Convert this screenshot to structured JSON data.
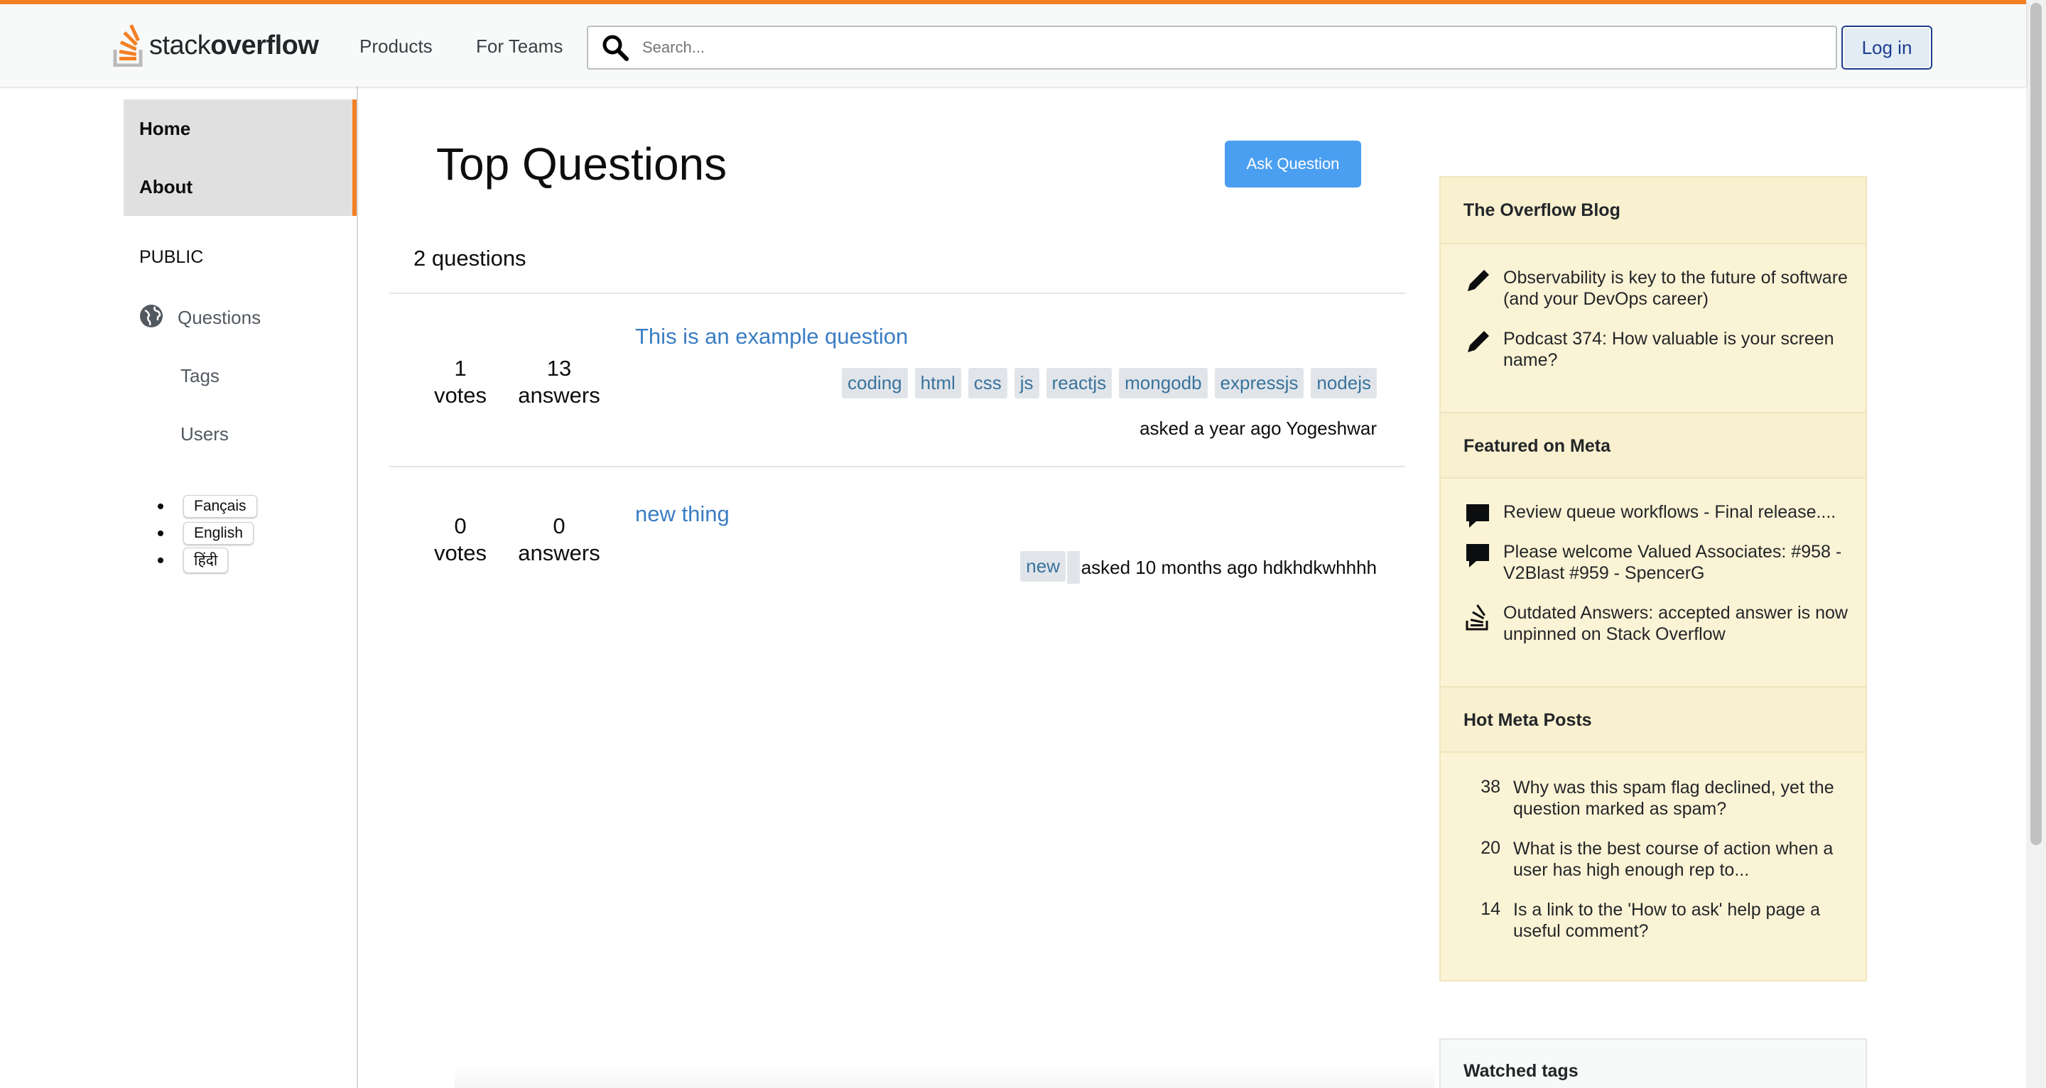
{
  "header": {
    "logo_text_light": "stack",
    "logo_text_bold": "overflow",
    "nav": [
      "Products",
      "For Teams"
    ],
    "search_placeholder": "Search...",
    "login_label": "Log in",
    "accent_color": "#f48024"
  },
  "sidebar": {
    "home_label": "Home",
    "about_label": "About",
    "public_label": "PUBLIC",
    "questions_label": "Questions",
    "tags_label": "Tags",
    "users_label": "Users",
    "languages": [
      "Fançais",
      "English",
      "हिंदी"
    ]
  },
  "main": {
    "title": "Top Questions",
    "ask_label": "Ask Question",
    "count_label": "2 questions",
    "questions": [
      {
        "votes": "1",
        "votes_label": "votes",
        "answers": "13",
        "answers_label": "answers",
        "title": "This is an example question",
        "tags": [
          "coding",
          "html",
          "css",
          "js",
          "reactjs",
          "mongodb",
          "expressjs",
          "nodejs"
        ],
        "asked": "asked a year ago Yogeshwar"
      },
      {
        "votes": "0",
        "votes_label": "votes",
        "answers": "0",
        "answers_label": "answers",
        "title": "new thing",
        "tags": [
          "new"
        ],
        "asked": "asked 10 months ago hdkhdkwhhhh"
      }
    ]
  },
  "widget": {
    "blog_heading": "The Overflow Blog",
    "blog_items": [
      {
        "icon": "pencil-icon",
        "text": "Observability is key to the future of software (and your DevOps career)"
      },
      {
        "icon": "pencil-icon",
        "text": "Podcast 374: How valuable is your screen name?"
      }
    ],
    "meta_heading": "Featured on Meta",
    "meta_items": [
      {
        "icon": "comment-icon",
        "text": "Review queue workflows - Final release...."
      },
      {
        "icon": "comment-icon",
        "text": "Please welcome Valued Associates: #958 - V2Blast #959 - SpencerG"
      },
      {
        "icon": "stack-icon",
        "text": "Outdated Answers: accepted answer is now unpinned on Stack Overflow"
      }
    ],
    "hot_heading": "Hot Meta Posts",
    "hot_items": [
      {
        "count": "38",
        "text": "Why was this spam flag declined, yet the question marked as spam?"
      },
      {
        "count": "20",
        "text": "What is the best course of action when a user has high enough rep to..."
      },
      {
        "count": "14",
        "text": "Is a link to the 'How to ask' help page a useful comment?"
      }
    ],
    "watched_heading": "Watched tags"
  }
}
